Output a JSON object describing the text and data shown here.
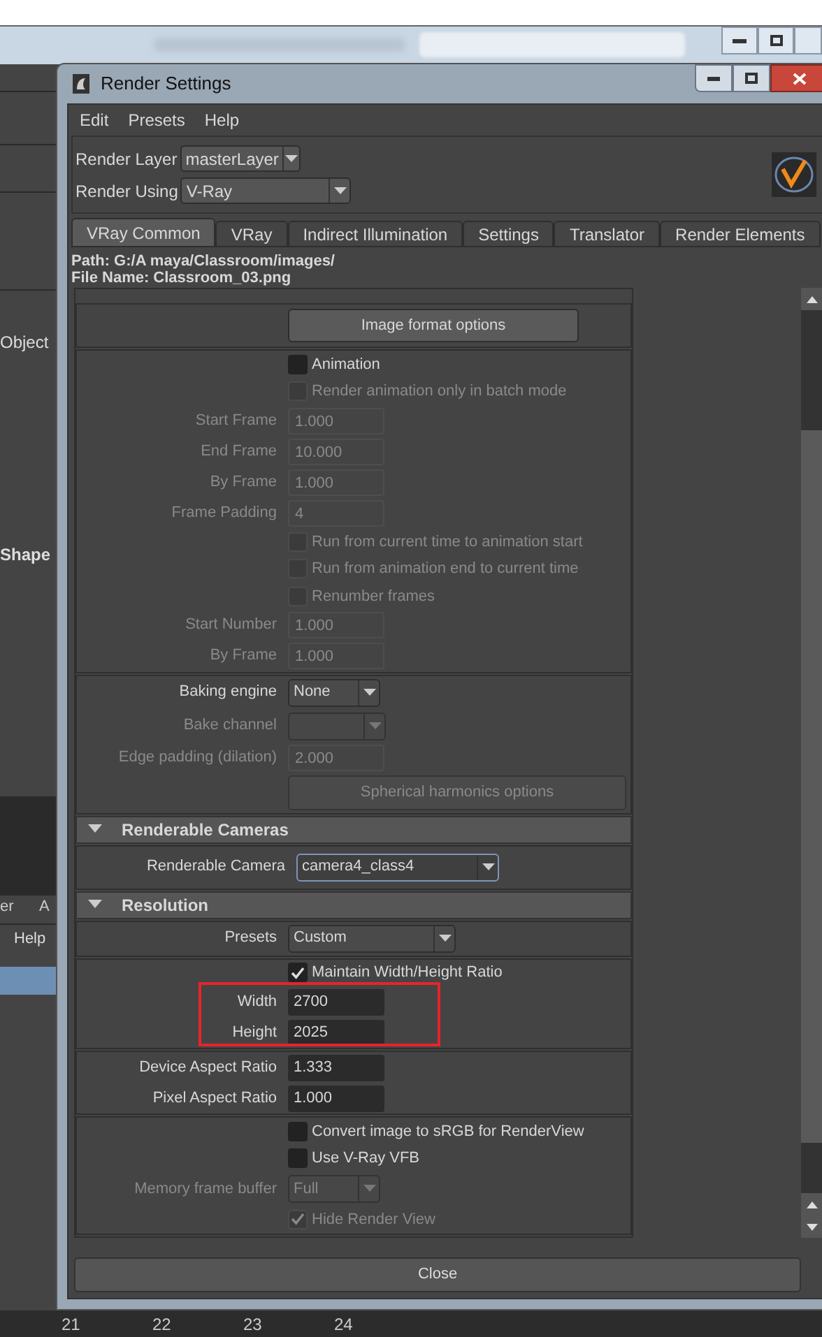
{
  "background": {
    "panel_labels": [
      "Object",
      "Shape"
    ],
    "tabs": [
      "er",
      "A"
    ],
    "menu": "Help",
    "timeline": [
      "21",
      "22",
      "23",
      "24"
    ]
  },
  "window": {
    "title": "Render Settings"
  },
  "menu": [
    "Edit",
    "Presets",
    "Help"
  ],
  "render_layer": {
    "label": "Render Layer",
    "value": "masterLayer"
  },
  "render_using": {
    "label": "Render Using",
    "value": "V-Ray"
  },
  "tabs": [
    {
      "label": "VRay Common",
      "selected": true
    },
    {
      "label": "VRay",
      "selected": false
    },
    {
      "label": "Indirect Illumination",
      "selected": false
    },
    {
      "label": "Settings",
      "selected": false
    },
    {
      "label": "Translator",
      "selected": false
    },
    {
      "label": "Render Elements",
      "selected": false
    }
  ],
  "path": "Path: G:/A maya/Classroom/images/",
  "file_name": "File Name: Classroom_03.png",
  "content": [
    {
      "kind": "group",
      "rows": [
        {
          "kind": "button",
          "label": "Image format options",
          "disabled": false
        }
      ]
    },
    {
      "kind": "group",
      "rows": [
        {
          "kind": "checkbox",
          "label": "Animation",
          "checked": false,
          "disabled": false
        },
        {
          "kind": "checkbox",
          "label": "Render animation only in batch mode",
          "checked": false,
          "disabled": true
        },
        {
          "kind": "field",
          "label": "Start Frame",
          "value": "1.000",
          "disabled": true
        },
        {
          "kind": "field",
          "label": "End Frame",
          "value": "10.000",
          "disabled": true
        },
        {
          "kind": "field",
          "label": "By Frame",
          "value": "1.000",
          "disabled": true
        },
        {
          "kind": "field",
          "label": "Frame Padding",
          "value": "4",
          "disabled": true
        },
        {
          "kind": "checkbox",
          "label": "Run from current time to animation start",
          "checked": false,
          "disabled": true
        },
        {
          "kind": "checkbox",
          "label": "Run from animation end to current time",
          "checked": false,
          "disabled": true
        },
        {
          "kind": "checkbox",
          "label": "Renumber frames",
          "checked": false,
          "disabled": true
        },
        {
          "kind": "field",
          "label": "Start Number",
          "value": "1.000",
          "disabled": true
        },
        {
          "kind": "field",
          "label": "By Frame",
          "value": "1.000",
          "disabled": true
        }
      ]
    },
    {
      "kind": "group",
      "rows": [
        {
          "kind": "dropdown",
          "label": "Baking engine",
          "value": "None",
          "disabled": false
        },
        {
          "kind": "dropdown",
          "label": "Bake channel",
          "disabled": true
        },
        {
          "kind": "field",
          "label": "Edge padding (dilation)",
          "value": "2.000",
          "disabled": true
        },
        {
          "kind": "wide_button",
          "label": "Spherical harmonics options",
          "disabled": true
        }
      ]
    },
    {
      "kind": "section",
      "title": "Renderable Cameras",
      "expanded": true
    },
    {
      "kind": "group",
      "rows": [
        {
          "kind": "camera",
          "label": "Renderable Camera",
          "value": "camera4_class4",
          "disabled": false
        }
      ]
    },
    {
      "kind": "section",
      "title": "Resolution",
      "expanded": true
    },
    {
      "kind": "group",
      "rows": [
        {
          "kind": "dropdown",
          "label": "Presets",
          "value": "Custom",
          "disabled": false
        }
      ]
    },
    {
      "kind": "group",
      "rows": [
        {
          "kind": "checkbox",
          "label": "Maintain Width/Height Ratio",
          "checked": true,
          "disabled": false,
          "highlighted": false
        },
        {
          "kind": "field",
          "label": "Width",
          "value": "2700",
          "disabled": false,
          "highlighted": true
        },
        {
          "kind": "field",
          "label": "Height",
          "value": "2025",
          "disabled": false,
          "highlighted": true
        }
      ]
    },
    {
      "kind": "group",
      "rows": [
        {
          "kind": "field",
          "label": "Device Aspect Ratio",
          "value": "1.333",
          "disabled": false
        },
        {
          "kind": "field",
          "label": "Pixel Aspect Ratio",
          "value": "1.000",
          "disabled": false
        }
      ]
    },
    {
      "kind": "group",
      "rows": [
        {
          "kind": "checkbox",
          "label": "Convert image to sRGB for RenderView",
          "checked": false,
          "disabled": false
        },
        {
          "kind": "checkbox",
          "label": "Use V-Ray VFB",
          "checked": false,
          "disabled": false
        },
        {
          "kind": "dropdown",
          "label": "Memory frame buffer",
          "value": "Full",
          "disabled": true
        },
        {
          "kind": "checkbox",
          "label": "Hide Render View",
          "checked": true,
          "disabled": true
        }
      ]
    }
  ],
  "close_button": "Close"
}
